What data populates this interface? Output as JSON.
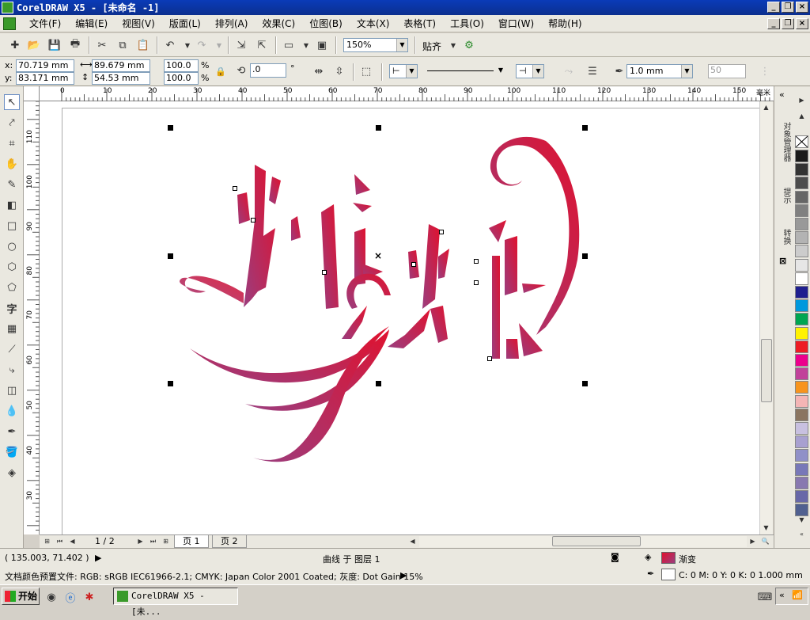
{
  "window": {
    "title": "CorelDRAW X5 - [未命名 -1]"
  },
  "menu": [
    "文件(F)",
    "编辑(E)",
    "视图(V)",
    "版面(L)",
    "排列(A)",
    "效果(C)",
    "位图(B)",
    "文本(X)",
    "表格(T)",
    "工具(O)",
    "窗口(W)",
    "帮助(H)"
  ],
  "toolbar": {
    "zoom": "150%",
    "snap_label": "贴齐"
  },
  "props": {
    "x_label": "x:",
    "x_value": "70.719 mm",
    "y_label": "y:",
    "y_value": "83.171 mm",
    "w_value": "89.679 mm",
    "h_value": "54.53 mm",
    "scale_x": "100.0",
    "scale_y": "100.0",
    "pct": "%",
    "rotation": ".0",
    "deg": "°",
    "outline_width": "1.0 mm",
    "bend": "50"
  },
  "ruler": {
    "h_ticks": [
      "0",
      "10",
      "20",
      "30",
      "40",
      "50",
      "60",
      "70",
      "80",
      "90",
      "100",
      "110",
      "120",
      "130",
      "140",
      "150"
    ],
    "h_unit": "毫米",
    "v_ticks": [
      "110",
      "100",
      "90",
      "80",
      "70",
      "60",
      "50",
      "40",
      "30"
    ]
  },
  "artwork": {
    "description_text": "辉煌",
    "gradient_start": "#e0112e",
    "gradient_end": "#9b3d7e"
  },
  "pages": {
    "counter": "1 / 2",
    "tabs": [
      "页 1",
      "页 2"
    ]
  },
  "status": {
    "coords": "( 135.003, 71.402 )",
    "object_info": "曲线 于 图层 1",
    "fill_label": "渐变",
    "profile": "文档颜色预置文件: RGB: sRGB IEC61966-2.1; CMYK: Japan Color 2001 Coated; 灰度: Dot Gain 15%",
    "outline_info": "C: 0 M: 0 Y: 0 K: 0  1.000 mm"
  },
  "docker_tabs": [
    "对象管理器",
    "提示",
    "转换"
  ],
  "palette": [
    "#1a1a1a",
    "#333333",
    "#4d4d4d",
    "#666666",
    "#808080",
    "#999999",
    "#b3b3b3",
    "#cccccc",
    "#e6e6e6",
    "#ffffff",
    "#1f1f8f",
    "#0099dd",
    "#00a651",
    "#fff200",
    "#ed1c24",
    "#ec008c",
    "#c1429a",
    "#f7941d",
    "#f4b5b5",
    "#8b7560",
    "#c8c0e0",
    "#a8a0d0",
    "#9090c8",
    "#7878b8",
    "#8878b0",
    "#6868a8",
    "#506090"
  ],
  "taskbar": {
    "start": "开始",
    "task": "CorelDRAW X5 - [未..."
  }
}
